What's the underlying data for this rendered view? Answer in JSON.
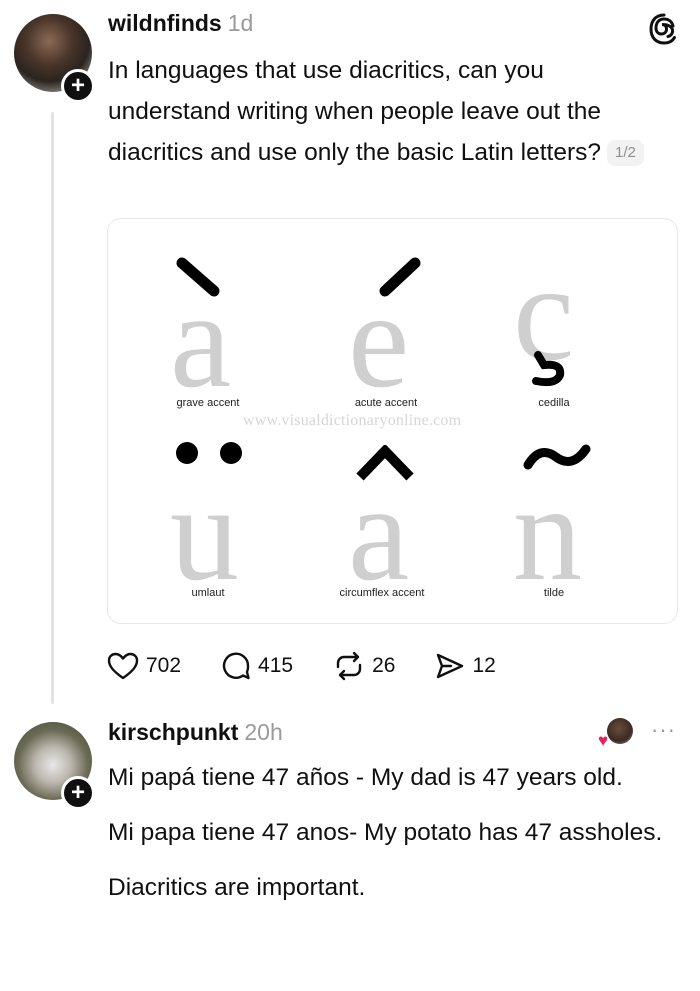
{
  "post1": {
    "username": "wildnfinds",
    "time": "1d",
    "text": "In languages that use diacritics, can you understand writing when people leave out the diacritics and use only the basic Latin letters?",
    "page_indicator": "1/2",
    "image": {
      "watermark": "www.visualdictionaryonline.com",
      "letters": [
        {
          "glyph": "a",
          "mark": "`",
          "caption": "grave accent"
        },
        {
          "glyph": "e",
          "mark": "´",
          "caption": "acute accent"
        },
        {
          "glyph": "c",
          "mark": "¸",
          "caption": "cedilla"
        },
        {
          "glyph": "u",
          "mark": "¨",
          "caption": "umlaut"
        },
        {
          "glyph": "a",
          "mark": "^",
          "caption": "circumflex accent"
        },
        {
          "glyph": "n",
          "mark": "~",
          "caption": "tilde"
        }
      ]
    },
    "actions": {
      "likes": "702",
      "replies": "415",
      "reposts": "26",
      "shares": "12"
    }
  },
  "post2": {
    "username": "kirschpunkt",
    "time": "20h",
    "paragraphs": [
      "Mi papá tiene 47 años - My dad is 47 years old.",
      "Mi papa tiene 47 anos- My potato has 47 assholes.",
      "Diacritics are important."
    ],
    "more_icon": "···"
  },
  "icons": {
    "threads_logo": "threads-logo-icon",
    "like": "heart-icon",
    "reply": "comment-icon",
    "repost": "repost-icon",
    "share": "send-icon"
  },
  "colors": {
    "text": "#101010",
    "muted": "#9a9a9a",
    "heart": "#e0245e",
    "thread_line": "#e3e3e3"
  }
}
